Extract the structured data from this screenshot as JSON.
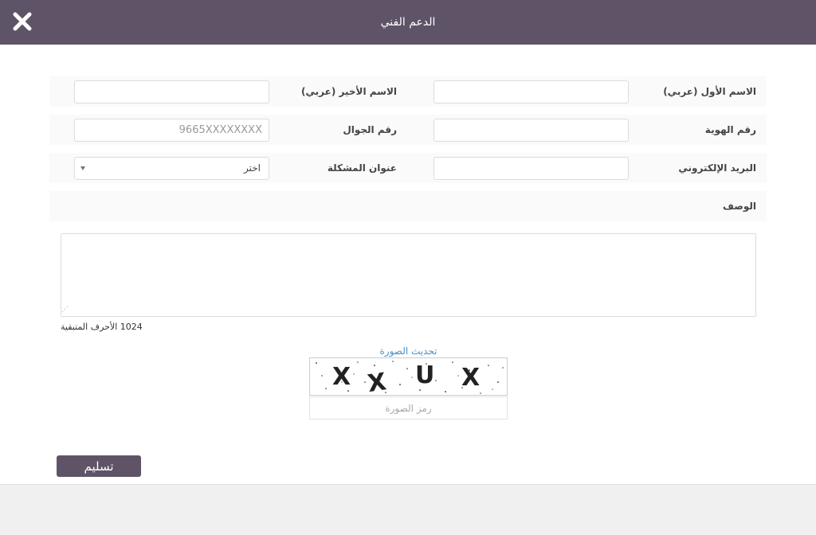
{
  "dialog": {
    "title": "الدعم الفني"
  },
  "form": {
    "first_name_label": "الاسم الأول (عربي)",
    "first_name_value": "",
    "last_name_label": "الاسم الأخير (عربي)",
    "last_name_value": "",
    "id_number_label": "رقم الهوية",
    "id_number_value": "",
    "mobile_label": "رقم الجوال",
    "mobile_placeholder": "9665XXXXXXXX",
    "email_label": "البريد الإلكتروني",
    "email_value": "",
    "issue_title_label": "عنوان المشكلة",
    "issue_title_selected": "اختر",
    "description_label": "الوصف",
    "description_value": "",
    "chars_remaining": "1024 الأحرف المتبقية"
  },
  "captcha": {
    "refresh_label": "تحديث الصورة",
    "text": "XXUX",
    "input_placeholder": "رمز الصورة"
  },
  "submit_label": "تسليم",
  "icons": {
    "close": "close-icon",
    "select_caret": "caret-down-icon"
  },
  "colors": {
    "header_bg": "#5f5467",
    "button_bg": "#5f5467",
    "link": "#4a90c6"
  }
}
